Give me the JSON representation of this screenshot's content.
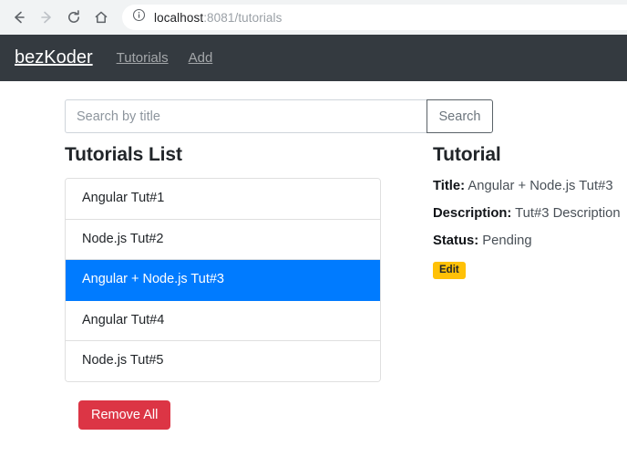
{
  "browser": {
    "back_icon": "arrow-left-icon",
    "forward_icon": "arrow-right-icon",
    "reload_icon": "reload-icon",
    "home_icon": "home-icon",
    "site_info_icon": "info-circle-icon",
    "url_host": "localhost",
    "url_path": ":8081/tutorials"
  },
  "navbar": {
    "brand": "bezKoder",
    "links": [
      {
        "label": "Tutorials"
      },
      {
        "label": "Add"
      }
    ]
  },
  "search": {
    "value": "",
    "placeholder": "Search by title",
    "button_label": "Search"
  },
  "list_panel": {
    "title": "Tutorials List",
    "items": [
      {
        "label": "Angular Tut#1",
        "active": false
      },
      {
        "label": "Node.js Tut#2",
        "active": false
      },
      {
        "label": "Angular + Node.js Tut#3",
        "active": true
      },
      {
        "label": "Angular Tut#4",
        "active": false
      },
      {
        "label": "Node.js Tut#5",
        "active": false
      }
    ],
    "remove_all_label": "Remove All"
  },
  "detail_panel": {
    "title": "Tutorial",
    "title_label": "Title:",
    "title_value": "Angular + Node.js Tut#3",
    "description_label": "Description:",
    "description_value": "Tut#3 Description",
    "status_label": "Status:",
    "status_value": "Pending",
    "edit_label": "Edit"
  },
  "colors": {
    "navbar_bg": "#343a40",
    "primary": "#007bff",
    "danger": "#dc3545",
    "warning": "#ffc107",
    "chrome_bg": "#f1f3f4"
  }
}
